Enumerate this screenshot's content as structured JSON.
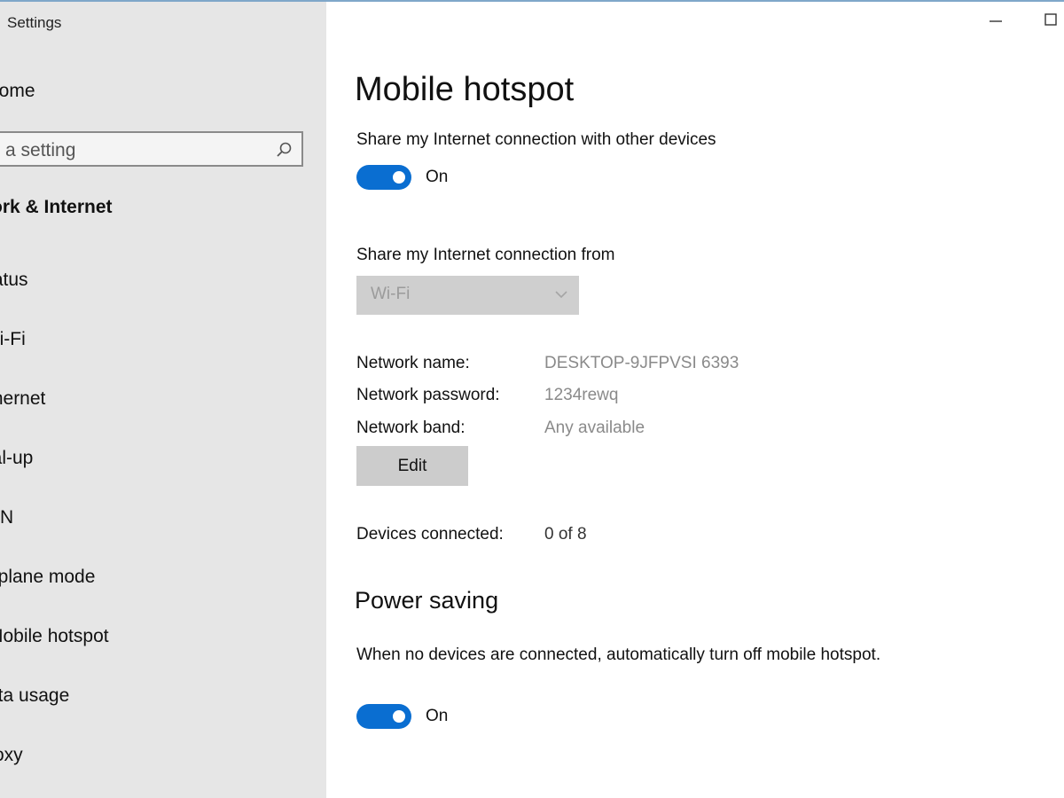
{
  "window": {
    "title": "Settings"
  },
  "sidebar": {
    "home_label": "lome",
    "search_placeholder": "a setting",
    "section_title": "ork & Internet",
    "items": [
      {
        "label": "tatus"
      },
      {
        "label": "Vi-Fi"
      },
      {
        "label": "thernet"
      },
      {
        "label": "ial-up"
      },
      {
        "label": "PN"
      },
      {
        "label": "irplane mode"
      },
      {
        "label": "Mobile hotspot"
      },
      {
        "label": "ata usage"
      },
      {
        "label": "roxy"
      }
    ]
  },
  "main": {
    "title": "Mobile hotspot",
    "share_label": "Share my Internet connection with other devices",
    "share_toggle": {
      "state": "On",
      "on": true
    },
    "share_from_label": "Share my Internet connection from",
    "share_from_value": "Wi-Fi",
    "network": {
      "name_label": "Network name:",
      "name_value": "DESKTOP-9JFPVSI 6393",
      "password_label": "Network password:",
      "password_value": "1234rewq",
      "band_label": "Network band:",
      "band_value": "Any available"
    },
    "edit_label": "Edit",
    "devices_label": "Devices connected:",
    "devices_value": "0 of 8",
    "power_saving": {
      "heading": "Power saving",
      "description": "When no devices are connected, automatically turn off mobile hotspot.",
      "toggle": {
        "state": "On",
        "on": true
      }
    }
  },
  "colors": {
    "accent": "#0a6ed1",
    "sidebar_bg": "#e6e6e6",
    "disabled_text": "#8a8a8a"
  }
}
